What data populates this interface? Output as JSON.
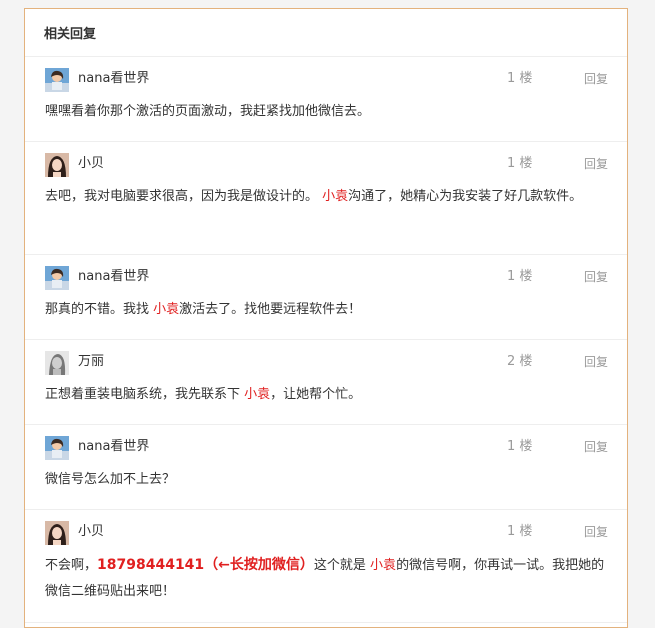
{
  "section_title": "相关回复",
  "reply_label": "回复",
  "replies": [
    {
      "user": "nana看世界",
      "avatar": "avatar-nana",
      "floor": "1 楼",
      "segments": [
        {
          "text": "嘿嘿看着你那个激活的页面激动，我赶紧找加他微信去。",
          "style": "normal"
        }
      ]
    },
    {
      "user": "小贝",
      "avatar": "avatar-xiaobei",
      "floor": "1 楼",
      "segments": [
        {
          "text": "去吧，我对电脑要求很高，因为我是做设计的。 ",
          "style": "normal"
        },
        {
          "text": "小袁",
          "style": "red"
        },
        {
          "text": "沟通了，她精心为我安装了好几款软件。",
          "style": "normal"
        }
      ]
    },
    {
      "user": "nana看世界",
      "avatar": "avatar-nana",
      "floor": "1 楼",
      "segments": [
        {
          "text": "那真的不错。我找 ",
          "style": "normal"
        },
        {
          "text": "小袁",
          "style": "red"
        },
        {
          "text": "激活去了。找他要远程软件去！",
          "style": "normal"
        }
      ]
    },
    {
      "user": "万丽",
      "avatar": "avatar-wanli",
      "floor": "2 楼",
      "segments": [
        {
          "text": "正想着重装电脑系统，我先联系下 ",
          "style": "normal"
        },
        {
          "text": "小袁",
          "style": "red"
        },
        {
          "text": "，让她帮个忙。",
          "style": "normal"
        }
      ]
    },
    {
      "user": "nana看世界",
      "avatar": "avatar-nana",
      "floor": "1 楼",
      "segments": [
        {
          "text": "微信号怎么加不上去？",
          "style": "normal"
        }
      ]
    },
    {
      "user": "小贝",
      "avatar": "avatar-xiaobei",
      "floor": "1 楼",
      "segments": [
        {
          "text": "不会啊，",
          "style": "normal"
        },
        {
          "text": "18798444141（←长按加微信）",
          "style": "strong"
        },
        {
          "text": "这个就是 ",
          "style": "normal"
        },
        {
          "text": "小袁",
          "style": "red"
        },
        {
          "text": "的微信号啊，你再试一试。我把她的微信二维码贴出来吧！",
          "style": "normal"
        }
      ]
    }
  ],
  "colors": {
    "panel_border": "#e3b27d",
    "highlight": "#e02020",
    "muted": "#9a9a9a"
  }
}
